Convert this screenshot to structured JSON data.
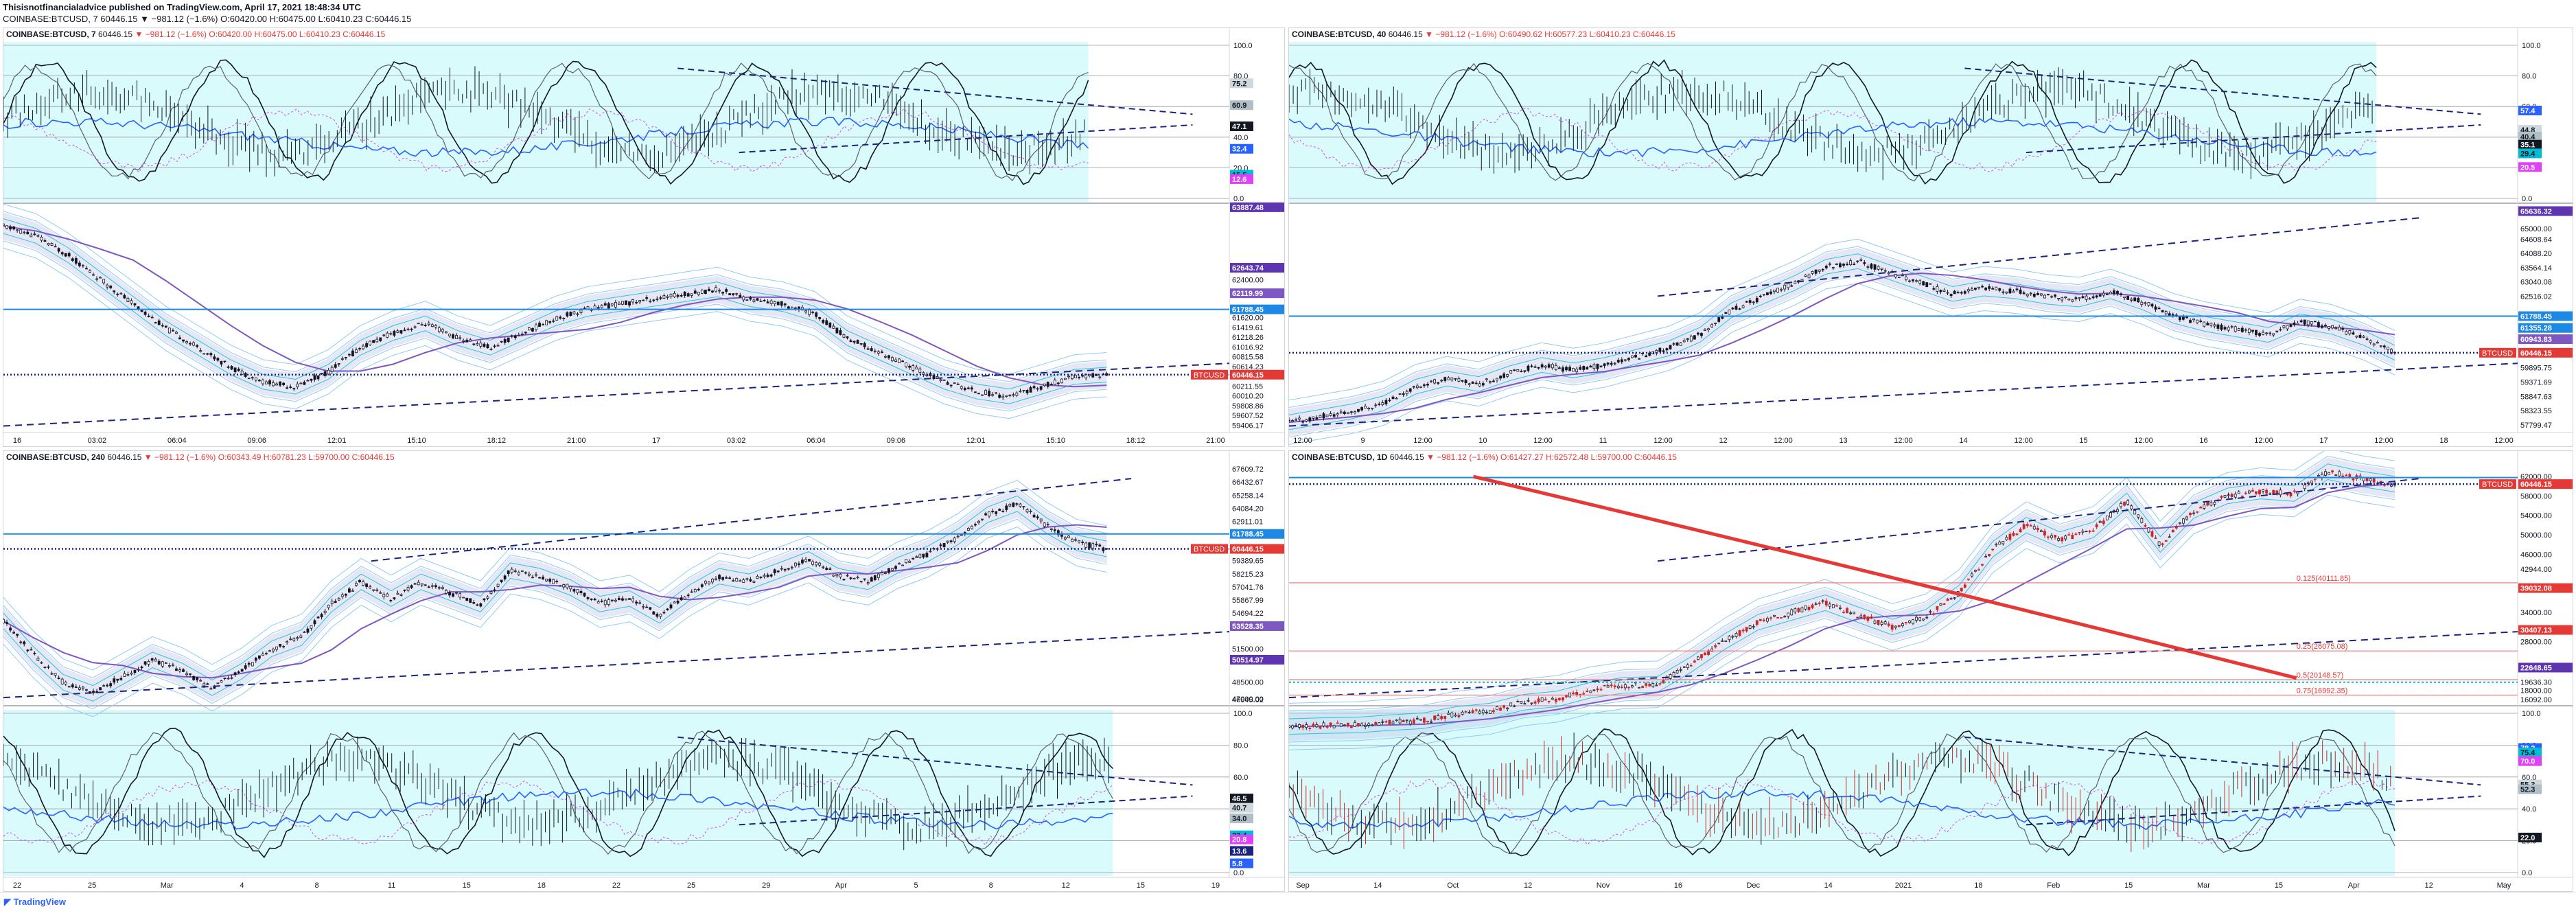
{
  "header": {
    "published": "Thisisnotfinancialadvice published on TradingView.com, April 17, 2021 18:48:34 UTC",
    "summary": "COINBASE:BTCUSD, 7  60446.15 ▼ −981.12 (−1.6%)  O:60420.00  H:60475.00  L:60410.23  C:60446.15"
  },
  "footer": {
    "brand": "TradingView"
  },
  "colors": {
    "cyanBand": "#d9fbfb",
    "blue": "#2962ff",
    "darkBlue": "#1a237e",
    "red": "#e53935",
    "purple": "#7b1fa2",
    "magenta": "#e040fb"
  },
  "chart_data": [
    {
      "id": "tl",
      "type": "line",
      "symbol": "COINBASE:BTCUSD, 7",
      "last": "60446.15",
      "chg": "▼ −981.12 (−1.6%)",
      "ohlc": "O:60420.00 H:60475.00 L:60410.23 C:60446.15",
      "osc_ticks": [
        "100.0",
        "80.0",
        "60.0",
        "40.0",
        "20.0",
        "0.0"
      ],
      "osc_labels": [
        {
          "v": 75.2,
          "t": "75.2",
          "c": "#cfd8dc",
          "tc": "#131722"
        },
        {
          "v": 60.9,
          "t": "60.9",
          "c": "#b0bec5",
          "tc": "#131722"
        },
        {
          "v": 47.1,
          "t": "47.1",
          "c": "#131722",
          "tc": "#ffffff"
        },
        {
          "v": 32.4,
          "t": "32.4",
          "c": "#2962ff",
          "tc": "#ffffff"
        },
        {
          "v": 15.5,
          "t": "15.5",
          "c": "#00bcd4",
          "tc": "#131722"
        },
        {
          "v": 12.6,
          "t": "12.6",
          "c": "#e040fb",
          "tc": "#ffffff"
        }
      ],
      "price_labels": [
        {
          "v": 63887.48,
          "t": "63887.48",
          "c": "#5e35b1"
        },
        {
          "v": 62643.74,
          "t": "62643.74",
          "c": "#5e35b1"
        },
        {
          "v": 62400,
          "t": "62400.00",
          "c": null
        },
        {
          "v": 62119.99,
          "t": "62119.99",
          "c": "#7e57c2"
        },
        {
          "v": 61788.45,
          "t": "61788.45",
          "c": "#1e88e5"
        },
        {
          "v": 61620,
          "t": "61620.00",
          "c": null
        },
        {
          "v": 61419.61,
          "t": "61419.61",
          "c": null
        },
        {
          "v": 61218.26,
          "t": "61218.26",
          "c": null
        },
        {
          "v": 61016.92,
          "t": "61016.92",
          "c": null
        },
        {
          "v": 60815.58,
          "t": "60815.58",
          "c": null
        },
        {
          "v": 60614.23,
          "t": "60614.23",
          "c": null
        },
        {
          "v": 60446.15,
          "t": "60446.15",
          "c": "#e53935"
        },
        {
          "v": 60211.55,
          "t": "60211.55",
          "c": null
        },
        {
          "v": 60010.2,
          "t": "60010.20",
          "c": null
        },
        {
          "v": 59808.86,
          "t": "59808.86",
          "c": null
        },
        {
          "v": 59607.52,
          "t": "59607.52",
          "c": null
        },
        {
          "v": 59406.17,
          "t": "59406.17",
          "c": null
        }
      ],
      "price_range": [
        59300,
        63900
      ],
      "x_labels": [
        "16",
        "03:02",
        "06:04",
        "09:06",
        "12:01",
        "15:10",
        "18:12",
        "21:00",
        "17",
        "03:02",
        "06:04",
        "09:06",
        "12:01",
        "15:10",
        "18:12",
        "21:00"
      ],
      "series": [
        {
          "name": "",
          "values": [
            63500,
            63300,
            62900,
            62400,
            61900,
            61400,
            61000,
            60600,
            60300,
            60200,
            60500,
            61000,
            61300,
            61500,
            61200,
            61000,
            61300,
            61600,
            61800,
            61900,
            62000,
            62100,
            62200,
            62000,
            61900,
            61700,
            61200,
            60900,
            60600,
            60300,
            60100,
            60000,
            60200,
            60400,
            60446
          ]
        }
      ]
    },
    {
      "id": "tr",
      "type": "line",
      "symbol": "COINBASE:BTCUSD, 40",
      "last": "60446.15",
      "chg": "▼ −981.12 (−1.6%)",
      "ohlc": "O:60490.62 H:60577.23 L:60410.23 C:60446.15",
      "osc_ticks": [
        "100.0",
        "80.0",
        "60.0",
        "40.0",
        "20.0",
        "0.0"
      ],
      "osc_labels": [
        {
          "v": 57.4,
          "t": "57.4",
          "c": "#2962ff",
          "tc": "#ffffff"
        },
        {
          "v": 44.8,
          "t": "44.8",
          "c": "#cfd8dc",
          "tc": "#131722"
        },
        {
          "v": 40.4,
          "t": "40.4",
          "c": "#b0bec5",
          "tc": "#131722"
        },
        {
          "v": 35.1,
          "t": "35.1",
          "c": "#131722",
          "tc": "#ffffff"
        },
        {
          "v": 29.4,
          "t": "29.4",
          "c": "#00bcd4",
          "tc": "#131722"
        },
        {
          "v": 20.5,
          "t": "20.5",
          "c": "#e040fb",
          "tc": "#ffffff"
        }
      ],
      "price_labels": [
        {
          "v": 65636.32,
          "t": "65636.32",
          "c": "#5e35b1"
        },
        {
          "v": 65000,
          "t": "65000.00",
          "c": null
        },
        {
          "v": 64608.64,
          "t": "64608.64",
          "c": null
        },
        {
          "v": 64088.2,
          "t": "64088.20",
          "c": null
        },
        {
          "v": 63564.14,
          "t": "63564.14",
          "c": null
        },
        {
          "v": 63040.08,
          "t": "63040.08",
          "c": null
        },
        {
          "v": 62516.02,
          "t": "62516.02",
          "c": null
        },
        {
          "v": 61788.45,
          "t": "61788.45",
          "c": "#1e88e5"
        },
        {
          "v": 61355.28,
          "t": "61355.28",
          "c": "#1e88e5"
        },
        {
          "v": 60943.83,
          "t": "60943.83",
          "c": "#7e57c2"
        },
        {
          "v": 60446.15,
          "t": "60446.15",
          "c": "#e53935"
        },
        {
          "v": 59895.75,
          "t": "59895.75",
          "c": null
        },
        {
          "v": 59371.69,
          "t": "59371.69",
          "c": null
        },
        {
          "v": 58847.63,
          "t": "58847.63",
          "c": null
        },
        {
          "v": 58323.55,
          "t": "58323.55",
          "c": null
        },
        {
          "v": 57799.47,
          "t": "57799.47",
          "c": null
        }
      ],
      "price_range": [
        57600,
        65800
      ],
      "x_labels": [
        "12:00",
        "9",
        "12:00",
        "10",
        "12:00",
        "11",
        "12:00",
        "12",
        "12:00",
        "13",
        "12:00",
        "14",
        "12:00",
        "15",
        "12:00",
        "16",
        "12:00",
        "17",
        "12:00",
        "18",
        "12:00"
      ],
      "series": [
        {
          "name": "",
          "values": [
            57900,
            58100,
            58300,
            58600,
            59200,
            59500,
            59300,
            59700,
            60000,
            59800,
            60000,
            60300,
            60600,
            61100,
            62000,
            62500,
            63000,
            63600,
            63800,
            63400,
            63000,
            62600,
            62800,
            62700,
            62500,
            62400,
            62700,
            62300,
            61800,
            61500,
            61300,
            61100,
            61600,
            61400,
            61000,
            60446
          ]
        }
      ]
    },
    {
      "id": "bl",
      "type": "line",
      "symbol": "COINBASE:BTCUSD, 240",
      "last": "60446.15",
      "chg": "▼ −981.12 (−1.6%)",
      "ohlc": "O:60343.49 H:60781.23 L:59700.00 C:60446.15",
      "osc_ticks": [
        "100.0",
        "80.0",
        "60.0",
        "40.0",
        "20.0",
        "0.0"
      ],
      "osc_labels": [
        {
          "v": 46.5,
          "t": "46.5",
          "c": "#131722",
          "tc": "#ffffff"
        },
        {
          "v": 40.7,
          "t": "40.7",
          "c": "#cfd8dc",
          "tc": "#131722"
        },
        {
          "v": 34.0,
          "t": "34.0",
          "c": "#b0bec5",
          "tc": "#131722"
        },
        {
          "v": 23.4,
          "t": "23.4",
          "c": "#00bcd4",
          "tc": "#131722"
        },
        {
          "v": 20.8,
          "t": "20.8",
          "c": "#e040fb",
          "tc": "#ffffff"
        },
        {
          "v": 13.6,
          "t": "13.6",
          "c": "#1a237e",
          "tc": "#ffffff"
        },
        {
          "v": 5.8,
          "t": "5.8",
          "c": "#2962ff",
          "tc": "#ffffff"
        }
      ],
      "price_labels": [
        {
          "v": 67609.72,
          "t": "67609.72",
          "c": null
        },
        {
          "v": 66432.67,
          "t": "66432.67",
          "c": null
        },
        {
          "v": 65258.14,
          "t": "65258.14",
          "c": null
        },
        {
          "v": 64084.2,
          "t": "64084.20",
          "c": null
        },
        {
          "v": 62911.01,
          "t": "62911.01",
          "c": null
        },
        {
          "v": 61788.45,
          "t": "61788.45",
          "c": "#1e88e5"
        },
        {
          "v": 60446.15,
          "t": "60446.15",
          "c": "#e53935"
        },
        {
          "v": 59389.65,
          "t": "59389.65",
          "c": null
        },
        {
          "v": 58215.23,
          "t": "58215.23",
          "c": null
        },
        {
          "v": 57041.76,
          "t": "57041.76",
          "c": null
        },
        {
          "v": 55867.99,
          "t": "55867.99",
          "c": null
        },
        {
          "v": 54694.22,
          "t": "54694.22",
          "c": null
        },
        {
          "v": 53528.35,
          "t": "53528.35",
          "c": "#7e57c2"
        },
        {
          "v": 51500,
          "t": "51500.00",
          "c": null
        },
        {
          "v": 50514.97,
          "t": "50514.97",
          "c": "#5e35b1"
        },
        {
          "v": 48500,
          "t": "48500.00",
          "c": null
        },
        {
          "v": 47000,
          "t": "47000.00",
          "c": null
        },
        {
          "v": 46945.02,
          "t": "46945.02",
          "c": null
        }
      ],
      "price_range": [
        46700,
        67800
      ],
      "x_labels": [
        "22",
        "25",
        "Mar",
        "4",
        "8",
        "11",
        "15",
        "18",
        "22",
        "25",
        "29",
        "Apr",
        "5",
        "8",
        "12",
        "15",
        "19"
      ],
      "series": [
        {
          "name": "",
          "values": [
            54000,
            51000,
            48500,
            47500,
            49000,
            50500,
            49500,
            48000,
            49500,
            51500,
            52500,
            55500,
            57500,
            56000,
            57500,
            56500,
            55500,
            58500,
            58000,
            57000,
            55500,
            56000,
            54500,
            56500,
            58000,
            57500,
            58500,
            59500,
            58000,
            57500,
            59000,
            60000,
            61500,
            63500,
            64500,
            62500,
            61000,
            60446
          ]
        }
      ]
    },
    {
      "id": "br",
      "type": "line",
      "symbol": "COINBASE:BTCUSD, 1D",
      "last": "60446.15",
      "chg": "▼ −981.12 (−1.6%)",
      "ohlc": "O:61427.27 H:62572.48 L:59700.00 C:60446.15",
      "osc_ticks": [
        "100.0",
        "80.0",
        "60.0",
        "40.0",
        "20.0",
        "0.0"
      ],
      "osc_labels": [
        {
          "v": 78.2,
          "t": "78.2",
          "c": "#2962ff",
          "tc": "#ffffff"
        },
        {
          "v": 75.4,
          "t": "75.4",
          "c": "#00bcd4",
          "tc": "#131722"
        },
        {
          "v": 70.0,
          "t": "70.0",
          "c": "#e040fb",
          "tc": "#ffffff"
        },
        {
          "v": 55.3,
          "t": "55.3",
          "c": "#cfd8dc",
          "tc": "#131722"
        },
        {
          "v": 52.3,
          "t": "52.3",
          "c": "#b0bec5",
          "tc": "#131722"
        },
        {
          "v": 22.0,
          "t": "22.0",
          "c": "#131722",
          "tc": "#ffffff"
        }
      ],
      "price_labels": [
        {
          "v": 62000,
          "t": "62000.00",
          "c": null
        },
        {
          "v": 60446.15,
          "t": "60446.15",
          "c": "#e53935"
        },
        {
          "v": 58000,
          "t": "58000.00",
          "c": null
        },
        {
          "v": 54000,
          "t": "54000.00",
          "c": null
        },
        {
          "v": 50000,
          "t": "50000.00",
          "c": null
        },
        {
          "v": 46000,
          "t": "46000.00",
          "c": null
        },
        {
          "v": 42944,
          "t": "42944.00",
          "c": null
        },
        {
          "v": 39032.08,
          "t": "39032.08",
          "c": "#e53935"
        },
        {
          "v": 34000,
          "t": "34000.00",
          "c": null
        },
        {
          "v": 30407.13,
          "t": "30407.13",
          "c": "#e53935"
        },
        {
          "v": 28000,
          "t": "28000.00",
          "c": null
        },
        {
          "v": 22648.65,
          "t": "22648.65",
          "c": "#5e35b1"
        },
        {
          "v": 19636.3,
          "t": "19636.30",
          "c": null
        },
        {
          "v": 18000,
          "t": "18000.00",
          "c": null
        },
        {
          "v": 16092,
          "t": "16092.00",
          "c": null
        }
      ],
      "fib_labels": [
        {
          "v": 40111,
          "t": "0.125(40111.85)"
        },
        {
          "v": 26075,
          "t": "0.25(26075.08)"
        },
        {
          "v": 20148,
          "t": "0.5(20148.57)"
        },
        {
          "v": 16992,
          "t": "0.75(16992.35)"
        }
      ],
      "price_range": [
        15500,
        64000
      ],
      "x_labels": [
        "Sep",
        "14",
        "Oct",
        "12",
        "Nov",
        "16",
        "Dec",
        "14",
        "2021",
        "18",
        "Feb",
        "15",
        "Mar",
        "15",
        "Apr",
        "12",
        "May"
      ],
      "series": [
        {
          "name": "",
          "values": [
            10500,
            10700,
            10800,
            11300,
            11700,
            13000,
            13700,
            15500,
            16200,
            18000,
            19000,
            19200,
            23300,
            28000,
            32000,
            34000,
            36000,
            33500,
            31000,
            33000,
            38000,
            47000,
            52000,
            49000,
            51000,
            57000,
            48000,
            55000,
            58000,
            59000,
            58500,
            63000,
            61500,
            60446
          ]
        }
      ]
    }
  ]
}
